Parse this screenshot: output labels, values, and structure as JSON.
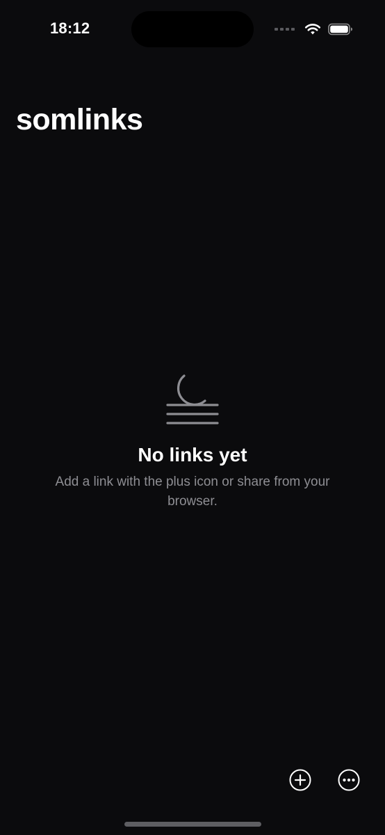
{
  "status_bar": {
    "time": "18:12",
    "icons": [
      "signal-icon",
      "wifi-icon",
      "battery-icon"
    ]
  },
  "app": {
    "title": "somlinks"
  },
  "empty_state": {
    "icon": "moon-haze-icon",
    "title": "No links yet",
    "description": "Add a link with the plus icon or share from your browser."
  },
  "toolbar": {
    "add_icon": "plus-circle-icon",
    "more_icon": "ellipsis-circle-icon"
  },
  "colors": {
    "background": "#0b0b0d",
    "text_primary": "#ffffff",
    "text_secondary": "#8e8e93",
    "icon_tint": "#8e8e93"
  }
}
